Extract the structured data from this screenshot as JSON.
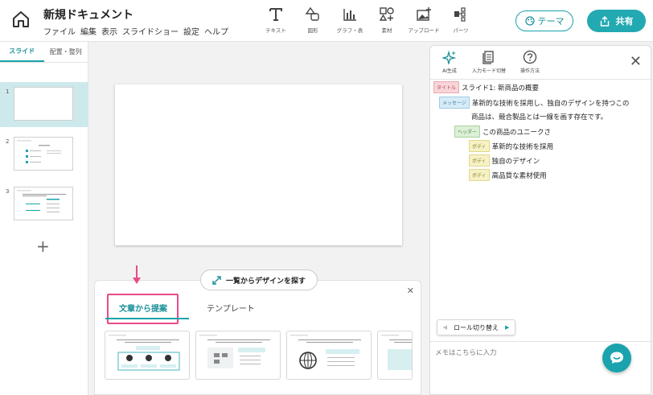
{
  "header": {
    "title": "新規ドキュメント",
    "menu": [
      "ファイル",
      "編集",
      "表示",
      "スライドショー",
      "設定",
      "ヘルプ"
    ],
    "tools": [
      {
        "label": "テキスト",
        "icon": "text-icon"
      },
      {
        "label": "図形",
        "icon": "shape-icon"
      },
      {
        "label": "グラフ・表",
        "icon": "chart-icon"
      },
      {
        "label": "素材",
        "icon": "assets-icon"
      },
      {
        "label": "アップロード",
        "icon": "upload-image-icon"
      },
      {
        "label": "パーツ",
        "icon": "parts-icon"
      }
    ],
    "theme_label": "テーマ",
    "share_label": "共有"
  },
  "left_panel": {
    "tabs": [
      "スライド",
      "配置・整列"
    ],
    "slides": [
      "1",
      "2",
      "3"
    ]
  },
  "suggest_panel": {
    "browse_label": "一覧からデザインを探す",
    "tabs": [
      "文章から提案",
      "テンプレート"
    ]
  },
  "right_panel": {
    "tools": [
      "AI生成",
      "入力モード切替",
      "操作方法"
    ],
    "outline": [
      {
        "tag": "タイトル",
        "text": "スライド1: 新商品の概要"
      },
      {
        "tag": "メッセージ",
        "text": "革新的な技術を採用し、独自のデザインを持つこの"
      },
      {
        "tag": "",
        "text": "商品は、競合製品とは一線を画す存在です。"
      },
      {
        "tag": "ヘッダー",
        "text": "この商品のユニークさ"
      },
      {
        "tag": "ボディ",
        "text": "革新的な技術を採用"
      },
      {
        "tag": "ボディ",
        "text": "独自のデザイン"
      },
      {
        "tag": "ボディ",
        "text": "高品質な素材使用"
      }
    ],
    "role_toggle": "ロール切り替え",
    "memo_placeholder": "メモはこちらに入力"
  },
  "colors": {
    "accent": "#1aa3ac",
    "highlight": "#e84a8a"
  }
}
